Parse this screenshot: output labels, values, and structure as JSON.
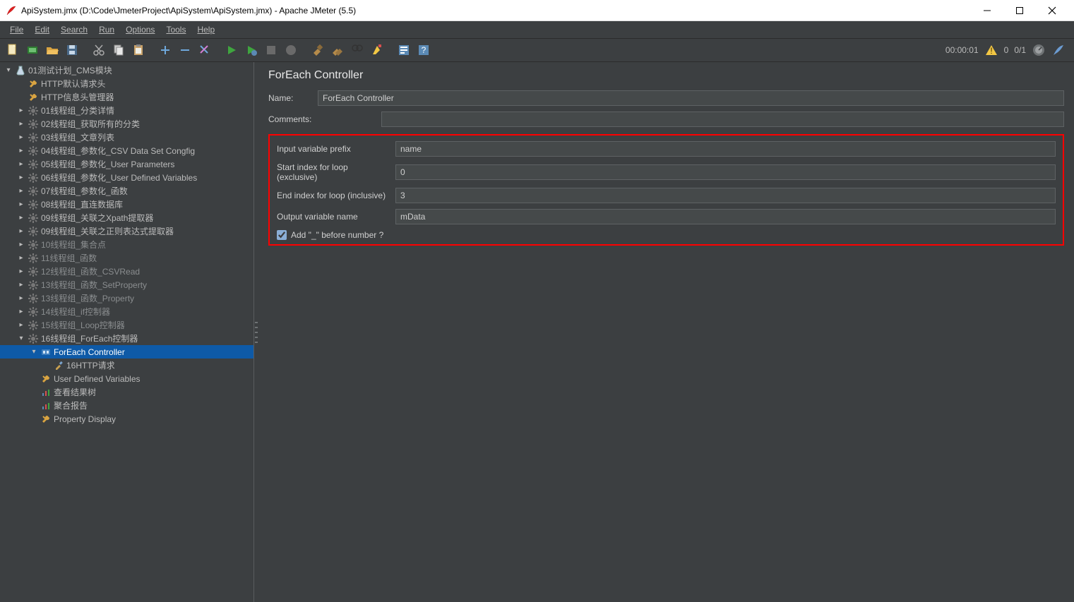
{
  "window": {
    "title": "ApiSystem.jmx (D:\\Code\\JmeterProject\\ApiSystem\\ApiSystem.jmx) - Apache JMeter (5.5)"
  },
  "menubar": {
    "items": [
      "File",
      "Edit",
      "Search",
      "Run",
      "Options",
      "Tools",
      "Help"
    ]
  },
  "status": {
    "elapsed": "00:00:01",
    "warnings": "0",
    "threads": "0/1"
  },
  "tree": {
    "root": "01测试计划_CMS模块",
    "header1": "HTTP默认请求头",
    "header2": "HTTP信息头管理器",
    "groups": [
      "01线程组_分类详情",
      "02线程组_获取所有的分类",
      "03线程组_文章列表",
      "04线程组_参数化_CSV Data Set Congfig",
      "05线程组_参数化_User Parameters",
      "06线程组_参数化_User Defined Variables",
      "07线程组_参数化_函数",
      "08线程组_直连数据库",
      "09线程组_关联之Xpath提取器",
      "09线程组_关联之正则表达式提取器",
      "10线程组_集合点",
      "11线程组_函数",
      "12线程组_函数_CSVRead",
      "13线程组_函数_SetProperty",
      "13线程组_函数_Property",
      "14线程组_if控制器",
      "15线程组_Loop控制器"
    ],
    "expanded_group": "16线程组_ForEach控制器",
    "foreach_node": "ForEach Controller",
    "http_req": "16HTTP请求",
    "udv": "User Defined Variables",
    "result_tree": "查看结果树",
    "agg_report": "聚合报告",
    "prop_display": "Property Display"
  },
  "panel": {
    "title": "ForEach Controller",
    "name_label": "Name:",
    "name_value": "ForEach Controller",
    "comments_label": "Comments:",
    "comments_value": "",
    "input_prefix_label": "Input variable prefix",
    "input_prefix_value": "name",
    "start_idx_label": "Start index for loop (exclusive)",
    "start_idx_value": "0",
    "end_idx_label": "End index for loop (inclusive)",
    "end_idx_value": "3",
    "output_var_label": "Output variable name",
    "output_var_value": "mData",
    "add_underscore_label": "Add \"_\" before number ?"
  }
}
